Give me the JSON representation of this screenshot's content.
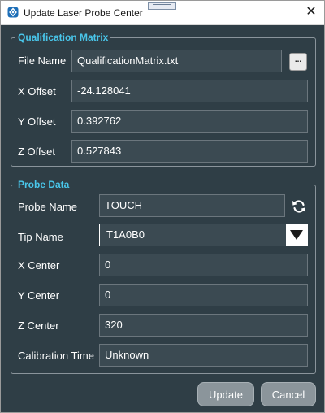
{
  "window": {
    "title": "Update Laser Probe Center"
  },
  "qualification_matrix": {
    "group_title": "Qualification Matrix",
    "file_name": {
      "label": "File Name",
      "value": "QualificationMatrix.txt",
      "browse_label": "..."
    },
    "x_offset": {
      "label": "X Offset",
      "value": "-24.128041"
    },
    "y_offset": {
      "label": "Y Offset",
      "value": "0.392762"
    },
    "z_offset": {
      "label": "Z Offset",
      "value": "0.527843"
    }
  },
  "probe_data": {
    "group_title": "Probe Data",
    "probe_name": {
      "label": "Probe Name",
      "value": "TOUCH"
    },
    "tip_name": {
      "label": "Tip Name",
      "value": "T1A0B0"
    },
    "x_center": {
      "label": "X Center",
      "value": "0"
    },
    "y_center": {
      "label": "Y Center",
      "value": "0"
    },
    "z_center": {
      "label": "Z Center",
      "value": "320"
    },
    "calibration_time": {
      "label": "Calibration Time",
      "value": "Unknown"
    }
  },
  "buttons": {
    "update": "Update",
    "cancel": "Cancel"
  },
  "icons": {
    "app": "app-logo-icon",
    "close": "close-icon",
    "refresh": "refresh-icon",
    "dropdown": "dropdown-arrow-icon"
  },
  "colors": {
    "background": "#2f3e46",
    "group_title": "#49c6ea",
    "button": "#8b959b"
  }
}
